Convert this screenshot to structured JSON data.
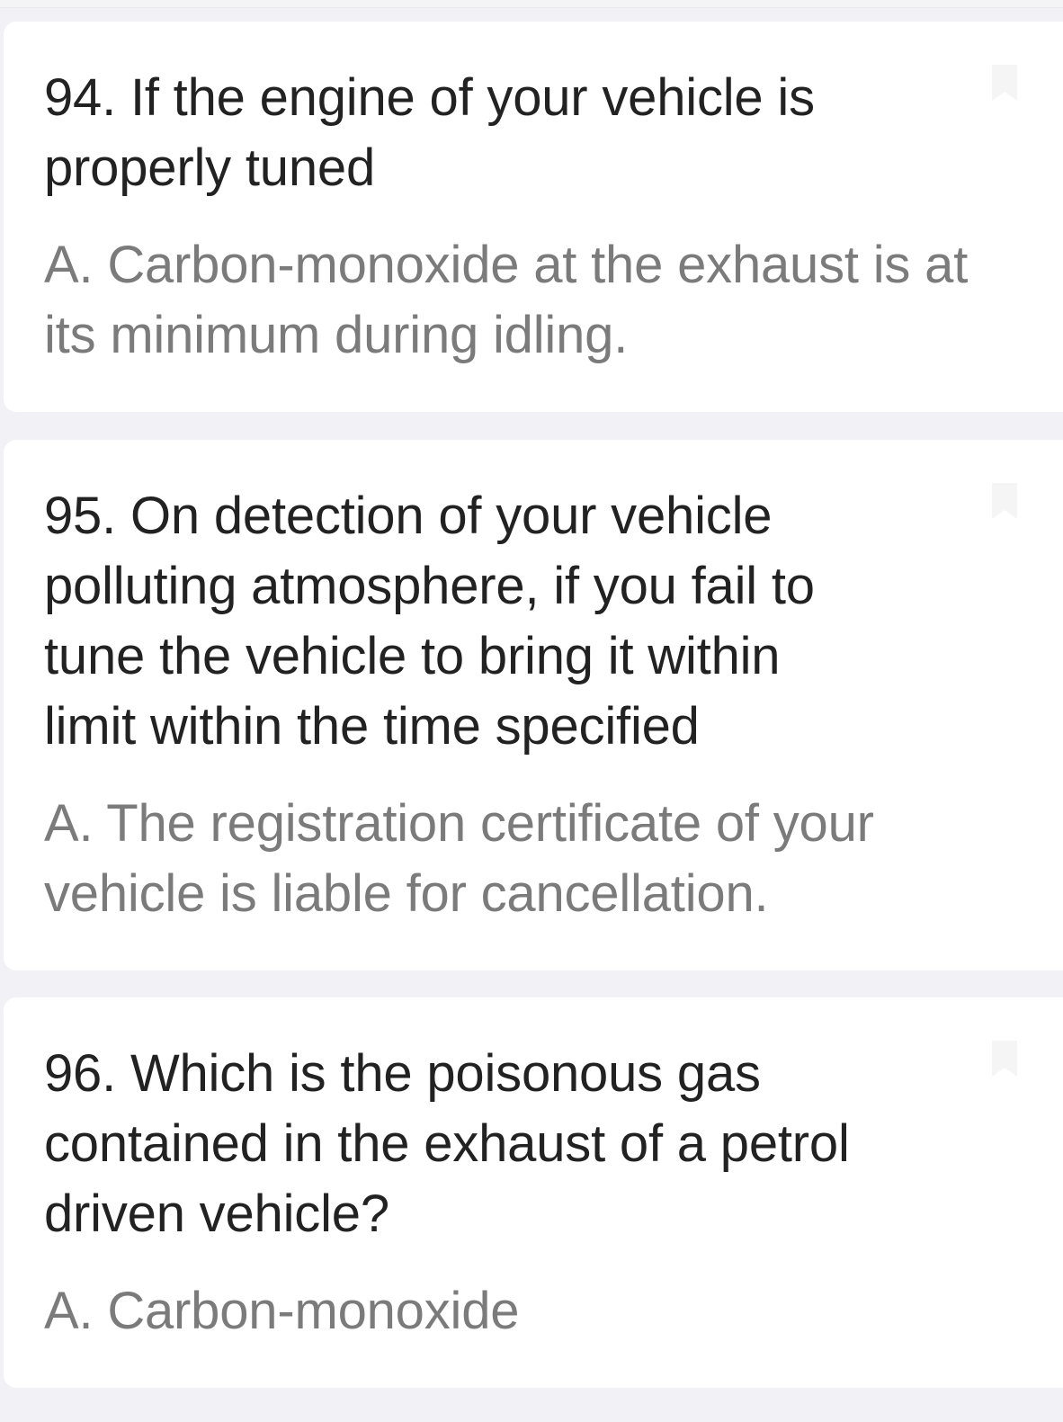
{
  "questions": [
    {
      "question_lines": [
        "94. If the engine of your vehicle is",
        "properly tuned"
      ],
      "answer_lines": [
        "A. Carbon-monoxide at the exhaust is at",
        "its minimum during idling."
      ]
    },
    {
      "question_lines": [
        "95. On detection of your vehicle",
        "polluting atmosphere, if you fail to",
        "tune the vehicle to bring it within",
        "limit within the time specified"
      ],
      "answer_lines": [
        "A. The registration certificate of your",
        "vehicle is liable for cancellation."
      ]
    },
    {
      "question_lines": [
        "96. Which is the poisonous gas",
        "contained in the exhaust of a petrol",
        "driven vehicle?"
      ],
      "answer_lines": [
        "A. Carbon-monoxide"
      ]
    }
  ],
  "icons": {
    "card_action": "bookmark-icon"
  },
  "colors": {
    "background": "#f1f1f6",
    "card": "#ffffff",
    "question_text": "#222222",
    "answer_text": "#7b7b7b"
  }
}
